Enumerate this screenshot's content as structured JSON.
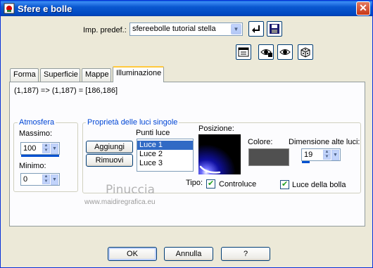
{
  "window": {
    "title": "Sfere e bolle"
  },
  "preset": {
    "label": "Imp. predef.:",
    "value": "sfereebolle tutorial stella"
  },
  "tabs": [
    "Forma",
    "Superficie",
    "Mappe",
    "Illuminazione"
  ],
  "active_tab": "Illuminazione",
  "coord_readout": "(1,187) => (1,187) = [186,186]",
  "atmosfera": {
    "title": "Atmosfera",
    "max_label": "Massimo:",
    "max_value": "100",
    "min_label": "Minimo:",
    "min_value": "0"
  },
  "lights": {
    "title": "Proprietà delle luci singole",
    "points_label": "Punti luce",
    "add_label": "Aggiungi",
    "remove_label": "Rimuovi",
    "items": [
      "Luce 1",
      "Luce 2",
      "Luce 3"
    ],
    "selected": "Luce 1",
    "position_label": "Posizione:",
    "color_label": "Colore:",
    "color_value": "#505050",
    "size_label": "Dimensione alte luci:",
    "size_value": "19",
    "type_label": "Tipo:",
    "backlight_label": "Controluce",
    "backlight_checked": true,
    "bubble_label": "Luce della bolla",
    "bubble_checked": true
  },
  "watermark": {
    "name": "Pinuccia",
    "url": "www.maidiregrafica.eu"
  },
  "buttons": {
    "ok": "OK",
    "cancel": "Annulla",
    "help": "?"
  },
  "colors": {
    "title_bar": "#0a58d0",
    "group_title": "#0046d5",
    "selection": "#316ac5"
  },
  "icons": [
    "preset-save-icon",
    "preset-delete-icon",
    "randomize-icon",
    "preview-toggle-icon",
    "eye-lock-icon",
    "eye-icon",
    "dice-icon"
  ]
}
